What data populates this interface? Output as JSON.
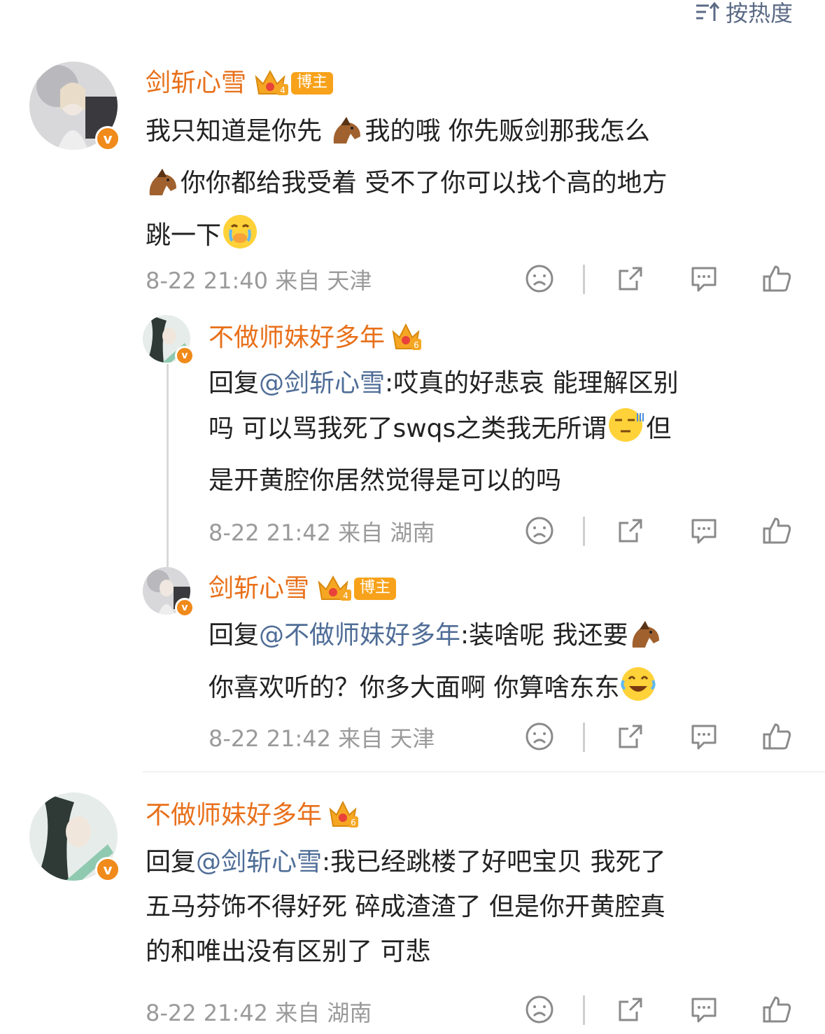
{
  "sort": {
    "label": "按热度",
    "icon": "sort-icon"
  },
  "comments": [
    {
      "user": "剑斩心雪",
      "tag": "博主",
      "text_lines": [
        [
          "我只知道是你先 ",
          "horse",
          "我的哦 你先贩剑那我怎么"
        ],
        [
          "horse",
          "你你都给我受着 受不了你可以找个高的地方"
        ],
        [
          "跳一下",
          "cry"
        ]
      ],
      "meta": "8-22 21:40 来自 天津"
    },
    {
      "user": "不做师妹好多年",
      "reply_prefix": "回复",
      "mention": "@剑斩心雪",
      "line1_rest": ":哎真的好悲哀 能理解区别",
      "line2": "吗 可以骂我死了swqs之类我无所谓",
      "line2_tail": "但",
      "line3": "是开黄腔你居然觉得是可以的吗",
      "meta": "8-22 21:42 来自 湖南"
    },
    {
      "user": "剑斩心雪",
      "tag": "博主",
      "reply_prefix": "回复",
      "mention": "@不做师妹好多年",
      "line1_rest": ":装啥呢 我还要",
      "line2": "你喜欢听的？你多大面啊 你算啥东东",
      "meta": "8-22 21:42 来自 天津"
    },
    {
      "user": "不做师妹好多年",
      "reply_prefix": "回复",
      "mention": "@剑斩心雪",
      "line1_rest": ":我已经跳楼了好吧宝贝 我死了",
      "line2": "五马芬饰不得好死 碎成渣渣了 但是你开黄腔真",
      "line3": "的和唯出没有区别了 可悲",
      "meta": "8-22 21:42 来自 湖南"
    }
  ],
  "colors": {
    "username": "#e8701a",
    "mention": "#4f6d97",
    "meta": "#9a9a9a",
    "vbadge": "#f08a1a"
  }
}
